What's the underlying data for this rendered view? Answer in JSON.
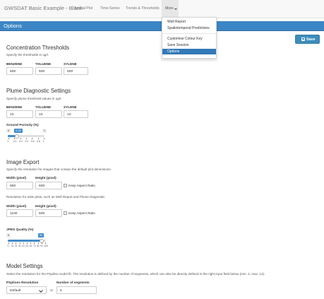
{
  "navbar": {
    "brand": "GWSDAT Basic Example - Blank",
    "tabs": [
      "Spatial Plot",
      "Time-Series",
      "Trends & Thresholds"
    ],
    "more_label": "More"
  },
  "dropdown": {
    "items": [
      "Well Report",
      "Spatiotemporal Predictions",
      "Customise Colour Key",
      "Save Session"
    ],
    "active": "Options"
  },
  "options_bar": {
    "title": "Options"
  },
  "save_button": {
    "label": "Save",
    "icon": "floppy-disk-icon"
  },
  "concentration": {
    "title": "Concentration Thresholds",
    "help": "Specify the thresholds in ug/l.",
    "fields": [
      {
        "label": "BENZENE",
        "value": "500"
      },
      {
        "label": "TOLUENE",
        "value": "500"
      },
      {
        "label": "XYLENE",
        "value": "500"
      }
    ]
  },
  "plume": {
    "title": "Plume Diagnostic Settings",
    "help": "Specify plume threshold values in ug/l.",
    "fields": [
      {
        "label": "BENZENE",
        "value": "10"
      },
      {
        "label": "TOLUENE",
        "value": "10"
      },
      {
        "label": "XYLENE",
        "value": "10"
      }
    ],
    "porosity": {
      "label": "Ground Porosity (%)",
      "min": "0",
      "max": "1",
      "value": "0.25",
      "ticks": [
        "0",
        "0.1",
        "0.2",
        "0.4",
        "0.6",
        "0.8",
        "1"
      ]
    }
  },
  "image_export": {
    "title": "Image Export",
    "help": "Specify the resolution for images that contain the default plot dimensions.",
    "width_label": "Width (pixel)",
    "height_label": "Height (pixel)",
    "width1": "800",
    "height1": "600",
    "keep_aspect": "Keep Aspect Ratio",
    "help2": "Resolution for wide plots, such as Well Report and Plume Diagnostic.",
    "width2": "1100",
    "height2": "600",
    "jpeg": {
      "label": "JPEG Quality (%)",
      "min": "0",
      "max": "100",
      "value": "90",
      "ticks": [
        "0",
        "11",
        "21",
        "31",
        "41",
        "51",
        "61",
        "71",
        "81",
        "91",
        "100"
      ]
    }
  },
  "model": {
    "title": "Model Settings",
    "help": "Select the resolution for the PSpline model fit. The resolution is defined by the number of segments, which can also be directly defined in the right input field below (min: 2, max: 12).",
    "resolution_label": "PSplines Resolution",
    "segments_label": "Number of segments",
    "resolution_value": "Default",
    "or_text": "or",
    "segments_value": "6"
  },
  "colors": {
    "options_bar": "#3b86c6",
    "accent": "#428bca",
    "dropdown_active": "#337ab7"
  }
}
